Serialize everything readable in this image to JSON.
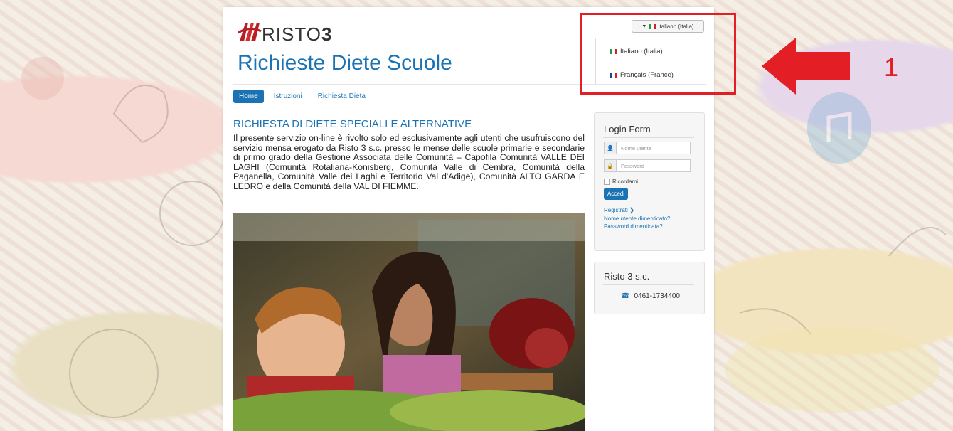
{
  "brand": {
    "logo_text_light": "RISTO",
    "logo_text_bold": "3",
    "site_title": "Richieste Diete Scuole"
  },
  "nav": {
    "items": [
      {
        "label": "Home",
        "active": true
      },
      {
        "label": "Istruzioni",
        "active": false
      },
      {
        "label": "Richiesta Dieta",
        "active": false
      }
    ]
  },
  "language": {
    "selected": "Italiano (Italia)",
    "options": [
      "Italiano (Italia)",
      "Français (France)"
    ]
  },
  "annotation": {
    "label": "1",
    "color": "#e31e24"
  },
  "article": {
    "title": "RICHIESTA DI DIETE SPECIALI E ALTERNATIVE",
    "body": "Il presente servizio on-line è rivolto solo ed esclusivamente agli utenti che usufruiscono del servizio mensa erogato da Risto 3 s.c. presso le mense delle scuole primarie e secondarie di primo grado della Gestione Associata delle Comunità – Capofila Comunità VALLE DEI LAGHI (Comunità Rotaliana-Konisberg, Comunità Valle di Cembra, Comunità della Paganella, Comunità Valle dei Laghi e Territorio Val d'Adige), Comunità ALTO GARDA E LEDRO e della Comunità della VAL DI FIEMME."
  },
  "login": {
    "title": "Login Form",
    "username_placeholder": "Nome utente",
    "password_placeholder": "Password",
    "remember_label": "Ricordami",
    "submit_label": "Accedi",
    "register_link": "Registrati",
    "forgot_username_link": "Nome utente dimenticato?",
    "forgot_password_link": "Password dimenticata?"
  },
  "contact": {
    "title": "Risto 3 s.c.",
    "phone": "0461-1734400"
  },
  "colors": {
    "primary": "#1b73b4",
    "highlight": "#e31e24"
  }
}
